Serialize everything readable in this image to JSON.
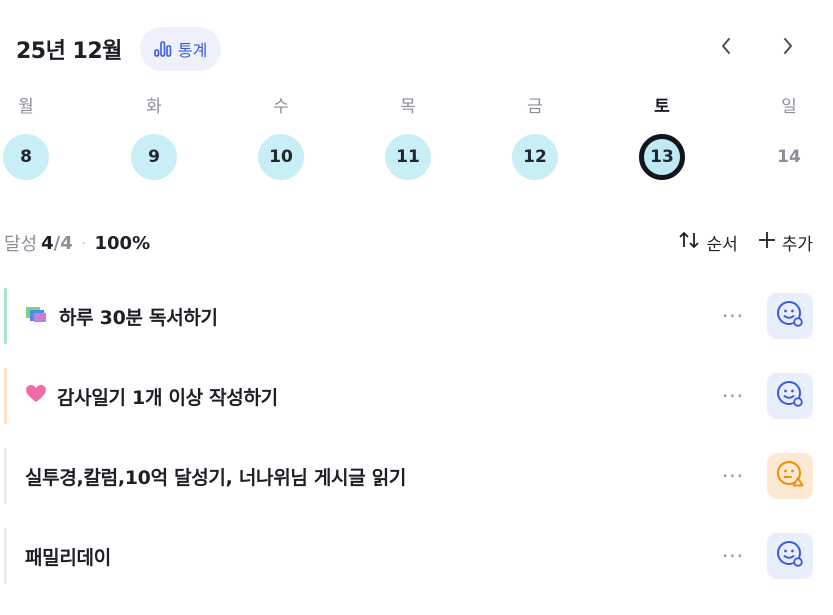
{
  "header": {
    "month_title": "25년 12월",
    "stats_label": "통계",
    "prev_icon": "chevron-left-icon",
    "next_icon": "chevron-right-icon"
  },
  "week": [
    {
      "weekday": "월",
      "day": "8",
      "state": "done"
    },
    {
      "weekday": "화",
      "day": "9",
      "state": "done"
    },
    {
      "weekday": "수",
      "day": "10",
      "state": "done"
    },
    {
      "weekday": "목",
      "day": "11",
      "state": "done"
    },
    {
      "weekday": "금",
      "day": "12",
      "state": "done"
    },
    {
      "weekday": "토",
      "day": "13",
      "state": "selected"
    },
    {
      "weekday": "일",
      "day": "14",
      "state": "future"
    }
  ],
  "summary": {
    "label": "달성",
    "done": "4",
    "total": "/4",
    "separator": "·",
    "percent": "100%"
  },
  "actions": {
    "sort_label": "순서",
    "sort_icon": "sort-arrows-icon",
    "add_label": "추가",
    "add_icon": "plus-icon"
  },
  "habits": [
    {
      "title": "하루 30분 독서하기",
      "emoji": "books-icon",
      "bar_color": "#a8e6cf",
      "more": "···",
      "mood": "smile",
      "mood_color": "#3b5bdb"
    },
    {
      "title": "감사일기 1개 이상 작성하기",
      "emoji": "heart-icon",
      "bar_color": "#fde0c4",
      "more": "···",
      "mood": "smile",
      "mood_color": "#3b5bdb"
    },
    {
      "title": "실투경,칼럼,10억 달성기, 너나위님 게시글 읽기",
      "emoji": "",
      "bar_color": "#e9ebef",
      "more": "···",
      "mood": "neutral",
      "mood_color": "#f08c00"
    },
    {
      "title": "패밀리데이",
      "emoji": "",
      "bar_color": "#e9ebef",
      "more": "···",
      "mood": "smile",
      "mood_color": "#3b5bdb"
    }
  ],
  "colors": {
    "accent": "#3b5bdb",
    "day_bg": "#c8eef6",
    "text": "#1c1f26",
    "muted": "#8b8f98"
  }
}
